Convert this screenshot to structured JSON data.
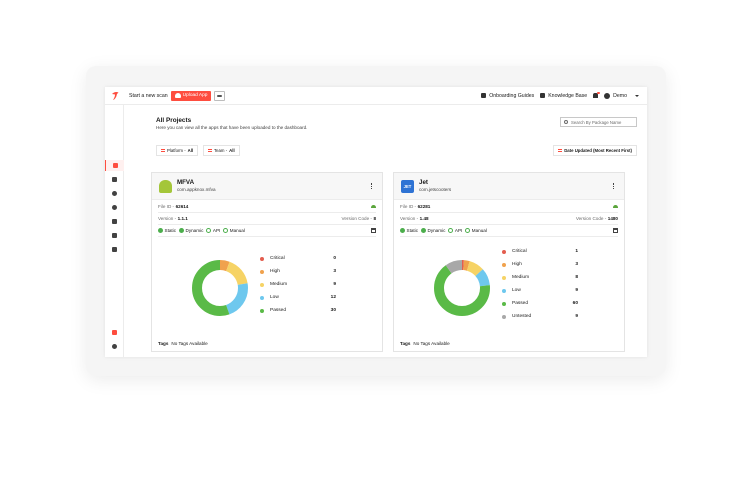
{
  "topbar": {
    "start_scan_label": "Start a new scan",
    "upload_label": "Upload App",
    "onboarding_label": "Onboarding Guides",
    "knowledge_label": "Knowledge Base",
    "user_label": "Demo"
  },
  "header": {
    "title": "All Projects",
    "subtitle": "Here you can view all the apps that have been uploaded to the dashboard.",
    "search_placeholder": "Search By Package Name",
    "filters": {
      "platform_prefix": "Platform - ",
      "platform_value": "All",
      "team_prefix": "Team - ",
      "team_value": "All",
      "sort_label": "Date Updated (Most Recent First)"
    }
  },
  "scan_types": [
    "Static",
    "Dynamic",
    "API",
    "Manual"
  ],
  "tags_label": "Tags",
  "no_tags": "No Tags Available",
  "labels": {
    "file_id": "File ID - ",
    "version": "Version - ",
    "version_code": "Version Code - "
  },
  "colors": {
    "brand": "#fe4d3f",
    "critical": "#e35d4e",
    "high": "#f0a24d",
    "medium": "#f6d365",
    "low": "#6ec8ee",
    "passed": "#5aba47",
    "untested": "#a8a8a8"
  },
  "projects": [
    {
      "name": "MFVA",
      "package": "com.appknox.mfva",
      "icon": "android-icon",
      "file_id": "62614",
      "version": "1.1.1",
      "version_code": "8",
      "stats": [
        {
          "label": "Critical",
          "value": 0
        },
        {
          "label": "High",
          "value": 3
        },
        {
          "label": "Medium",
          "value": 9
        },
        {
          "label": "Low",
          "value": 12
        },
        {
          "label": "Passed",
          "value": 30
        }
      ]
    },
    {
      "name": "Jet",
      "package": "com.jetscooters",
      "icon_text": "JET",
      "file_id": "62281",
      "version": "1.48",
      "version_code": "1480",
      "stats": [
        {
          "label": "Critical",
          "value": 1
        },
        {
          "label": "High",
          "value": 3
        },
        {
          "label": "Medium",
          "value": 8
        },
        {
          "label": "Low",
          "value": 9
        },
        {
          "label": "Passed",
          "value": 60
        },
        {
          "label": "Untested",
          "value": 9
        }
      ]
    }
  ]
}
